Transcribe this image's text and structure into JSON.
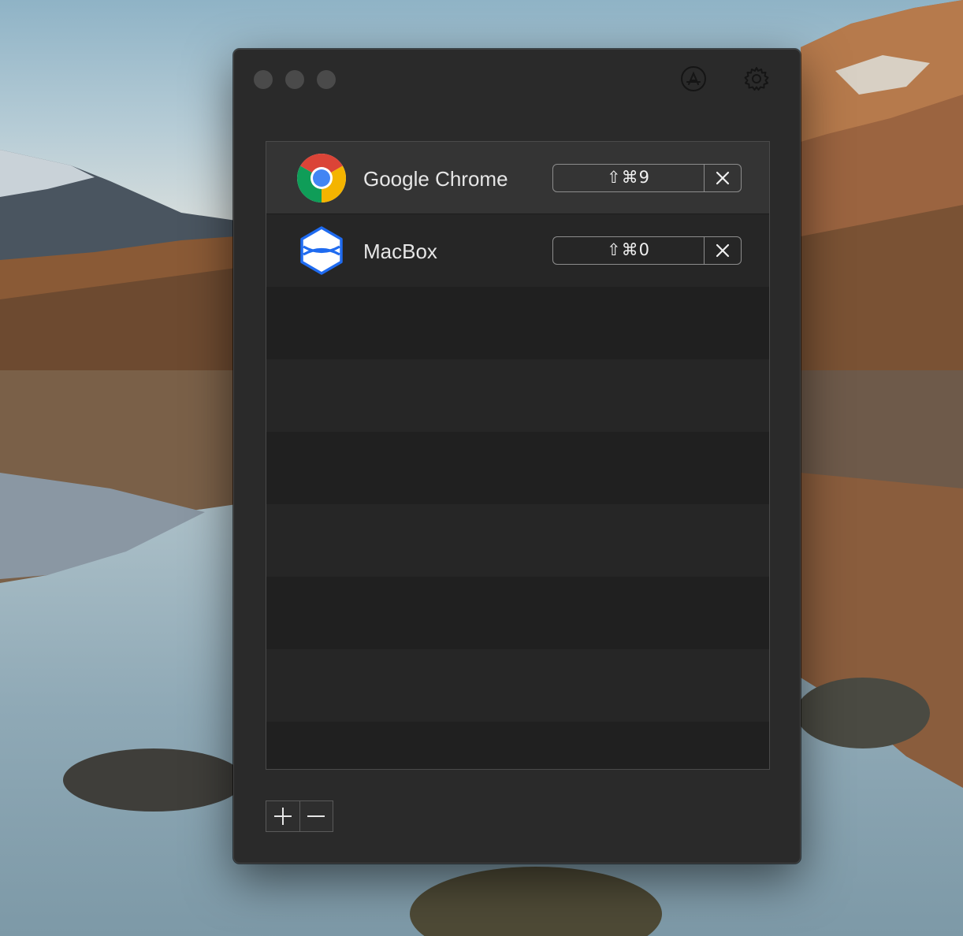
{
  "window": {
    "controls": [
      "close",
      "minimize",
      "zoom"
    ],
    "toolbar_icons": [
      "app-store-icon",
      "gear-icon"
    ]
  },
  "apps": [
    {
      "name": "Google Chrome",
      "shortcut": "⇧⌘9",
      "icon": "chrome-icon",
      "selected": true
    },
    {
      "name": "MacBox",
      "shortcut": "⇧⌘0",
      "icon": "macbox-icon",
      "selected": false
    }
  ],
  "footer": {
    "buttons": [
      "plus-icon",
      "minus-icon"
    ]
  },
  "colors": {
    "window_bg": "#2a2a2a",
    "row_selected": "#343434",
    "row_alt": "#262626",
    "text": "#e6e6e6",
    "macbox_blue": "#1f6bf0"
  }
}
